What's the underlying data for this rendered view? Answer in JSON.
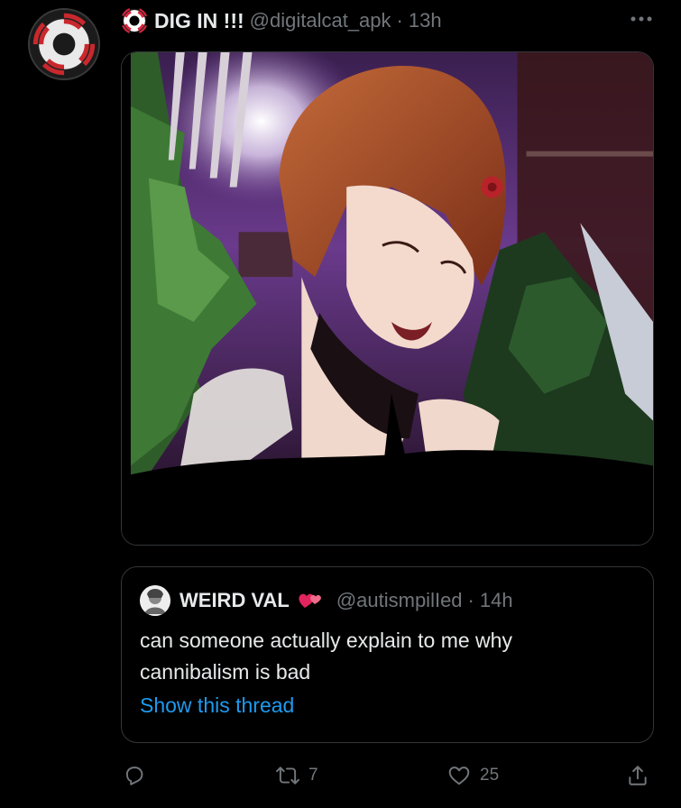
{
  "tweet": {
    "display_name": "DIG IN !!!",
    "handle": "@digitalcat_apk",
    "separator": "·",
    "time": "13h"
  },
  "quote": {
    "display_name": "WEIRD VAL",
    "handle": "@autismpilIed",
    "separator": "·",
    "time": "14h",
    "text": "can someone actually explain to me why cannibalism is bad",
    "show_thread": "Show this thread"
  },
  "actions": {
    "retweets": "7",
    "likes": "25"
  },
  "icons": {
    "author_badge": "lifebuoy-icon",
    "quote_badge": "hearts-icon",
    "menu": "more-icon",
    "reply": "reply-icon",
    "retweet": "retweet-icon",
    "like": "heart-icon",
    "share": "share-icon"
  },
  "colors": {
    "background": "#000000",
    "primary_text": "#e7e9ea",
    "secondary_text": "#71767b",
    "link": "#1d9bf0",
    "border": "#333639"
  }
}
